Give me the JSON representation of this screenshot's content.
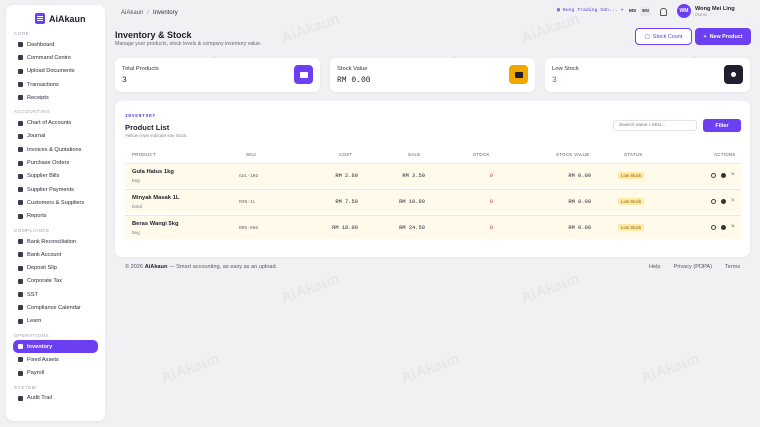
{
  "brand": {
    "name": "AiAkaun"
  },
  "breadcrumb": {
    "root": "AiAkaun",
    "separator": "/",
    "current": "Inventory"
  },
  "topbar": {
    "company": "Bung Trading Sdn...",
    "lang": [
      "MS",
      "EN"
    ],
    "active_lang": "EN",
    "user": {
      "initials": "WM",
      "name": "Wong Mei Ling",
      "role": "Owner"
    }
  },
  "sidebar": {
    "sections": [
      {
        "title": "CORE",
        "items": [
          "Dashboard",
          "Command Centre",
          "Upload Documents",
          "Transactions",
          "Receipts"
        ]
      },
      {
        "title": "ACCOUNTING",
        "items": [
          "Chart of Accounts",
          "Journal",
          "Invoices & Quotations",
          "Purchase Orders",
          "Supplier Bills",
          "Supplier Payments",
          "Customers & Suppliers",
          "Reports"
        ]
      },
      {
        "title": "COMPLIANCE",
        "items": [
          "Bank Reconciliation",
          "Bank Account",
          "Deposit Slip",
          "Corporate Tax",
          "SST",
          "Compliance Calendar",
          "Learn"
        ]
      },
      {
        "title": "OPERATIONS",
        "items": [
          "Inventory",
          "Fixed Assets",
          "Payroll"
        ]
      },
      {
        "title": "SYSTEM",
        "items": [
          "Audit Trail"
        ]
      }
    ],
    "active": "Inventory"
  },
  "page": {
    "title": "Inventory & Stock",
    "subtitle": "Manage your products, stock levels & company inventory value.",
    "stock_count_label": "Stock Count",
    "new_product_label": "New Product"
  },
  "stats": [
    {
      "label": "Total Products",
      "value": "3",
      "color": "#6d3ff2"
    },
    {
      "label": "Stock Value",
      "value": "RM 0.00",
      "color": "#f0a800"
    },
    {
      "label": "Low Stock",
      "value": "3",
      "color": "#1f1f2e"
    }
  ],
  "product_list": {
    "eyebrow": "INVENTORY",
    "title": "Product List",
    "hint": "Yellow rows indicate low stock.",
    "search_placeholder": "Search name / SKU...",
    "filter_label": "Filter",
    "columns": [
      "PRODUCT",
      "SKU",
      "COST",
      "SALE",
      "STOCK",
      "STOCK VALUE",
      "STATUS",
      "ACTIONS"
    ],
    "rows": [
      {
        "name": "Gula Halus 1kg",
        "unit": "beg",
        "sku": "GUL-1KG",
        "cost": "RM 2.60",
        "sale": "RM 3.50",
        "stock": "0",
        "stock_value": "RM 0.00",
        "status": "Low Stock"
      },
      {
        "name": "Minyak Masak 1L",
        "unit": "botol",
        "sku": "MIN-1L",
        "cost": "RM 7.50",
        "sale": "RM 10.90",
        "stock": "0",
        "stock_value": "RM 0.00",
        "status": "Low Stock"
      },
      {
        "name": "Beras Wangi 5kg",
        "unit": "beg",
        "sku": "BR5-5KG",
        "cost": "RM 18.00",
        "sale": "RM 24.50",
        "stock": "0",
        "stock_value": "RM 0.00",
        "status": "Low Stock"
      }
    ]
  },
  "footer": {
    "prefix": "© 2026",
    "brand": "AiAkaun",
    "tagline": "— Smart accounting, as easy as an upload.",
    "links": [
      "Help",
      "Privacy (PDPA)",
      "Terms"
    ]
  },
  "watermark": "AiAkaun"
}
